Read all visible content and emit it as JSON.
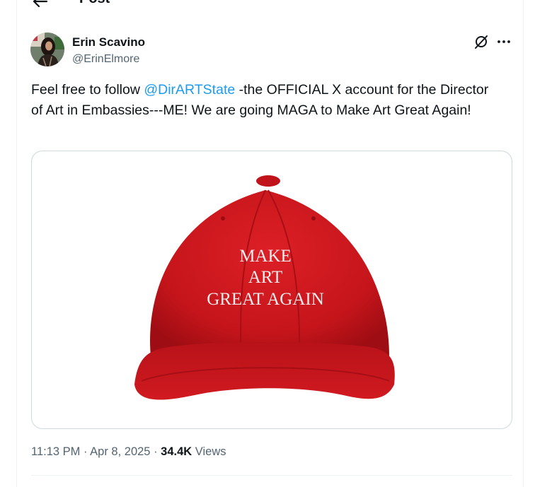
{
  "header": {
    "title": "Post",
    "back_icon": "arrow-left-icon"
  },
  "post": {
    "author_name": "Erin Scavino",
    "author_handle": "@ErinElmore",
    "text_before": "Feel free to follow ",
    "mention": "@DirARTState",
    "text_after": " -the OFFICIAL X account for the Director of Art in Embassies---ME! We are going MAGA to Make Art Great Again!",
    "image": {
      "hat_line1": "MAKE",
      "hat_line2": "ART",
      "hat_line3": "GREAT AGAIN"
    },
    "time": "11:13 PM",
    "sep1": " · ",
    "date": "Apr 8, 2025",
    "sep2": " · ",
    "views_count": "34.4K",
    "views_label": " Views"
  },
  "icons": {
    "grok": "grok-icon",
    "more": "more-icon"
  },
  "colors": {
    "link": "#1d9bf0",
    "secondary_text": "#536471",
    "hat_red": "#c8141b"
  }
}
